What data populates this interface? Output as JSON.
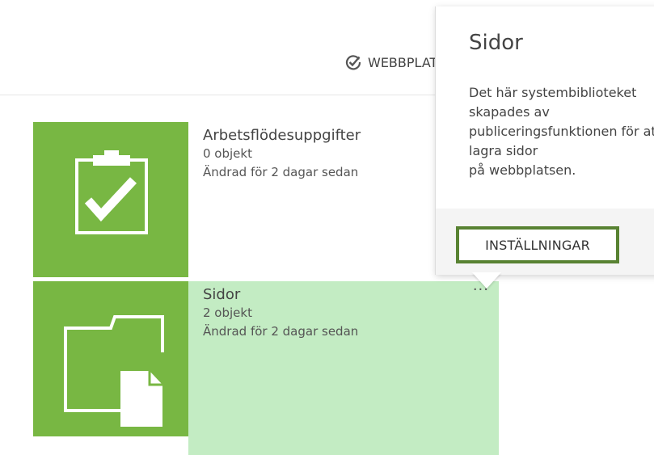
{
  "toolbar": {
    "action_label": "WEBBPLATSINNEHÅLL",
    "action_icon": "check-circle-icon"
  },
  "tiles": [
    {
      "title": "Arbetsflödesuppgifter",
      "count": "0 objekt",
      "modified": "Ändrad för 2 dagar sedan",
      "icon": "clipboard-check-icon",
      "color": "#78b743"
    },
    {
      "title": "Sidor",
      "count": "2 objekt",
      "modified": "Ändrad för 2 dagar sedan",
      "icon": "folder-document-icon",
      "color": "#78b743",
      "highlight_color": "#c3ecc3",
      "more_label": "···"
    }
  ],
  "callout": {
    "title": "Sidor",
    "description": "Det här systembiblioteket skapades av\npubliceringsfunktionen för att lagra sidor\npå webbplatsen.",
    "settings_label": "INSTÄLLNINGAR",
    "border_color": "#588232"
  }
}
